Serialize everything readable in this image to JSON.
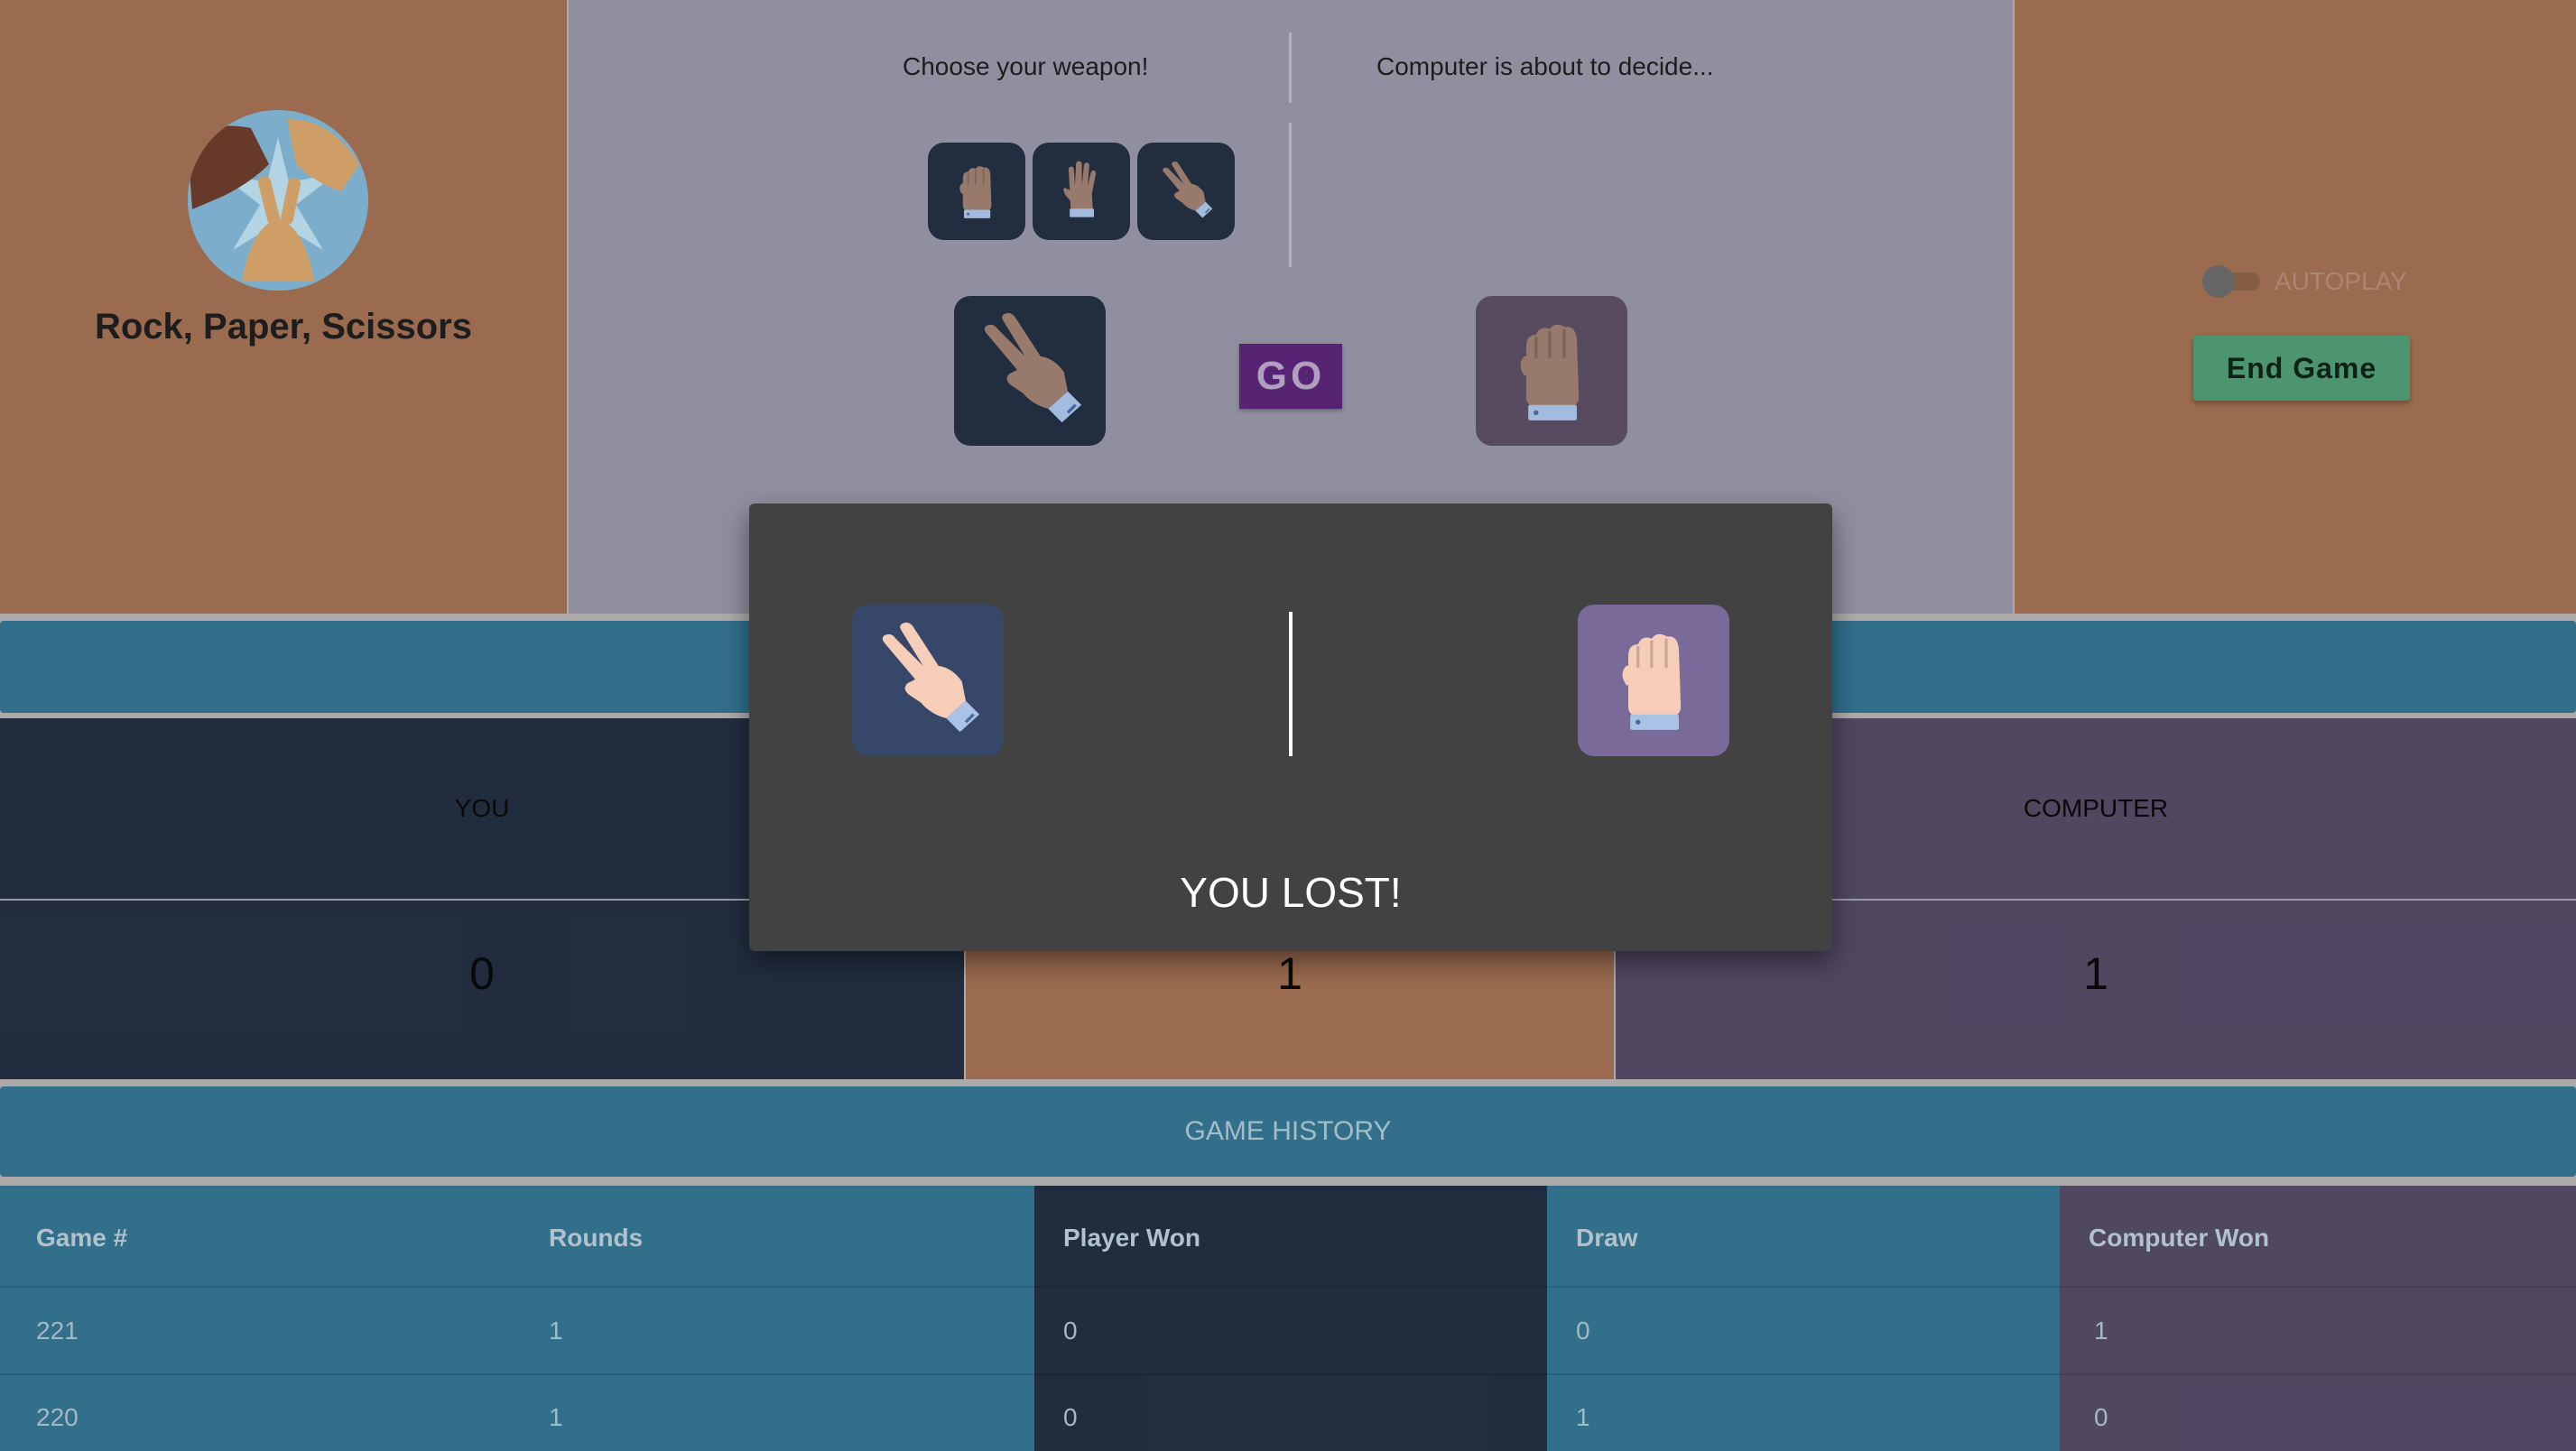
{
  "app": {
    "title": "Rock, Paper, Scissors",
    "logo_icon": "rock-paper-scissors-hands-logo"
  },
  "arena": {
    "player_prompt": "Choose your weapon!",
    "computer_prompt": "Computer is about to decide...",
    "weapons": [
      {
        "name": "rock",
        "icon": "fist-icon"
      },
      {
        "name": "paper",
        "icon": "open-hand-icon"
      },
      {
        "name": "scissors",
        "icon": "scissors-hand-icon"
      }
    ],
    "player_choice_icon": "scissors-hand-icon",
    "computer_choice_icon": "fist-icon",
    "go_label": "GO"
  },
  "controls": {
    "autoplay_label": "AUTOPLAY",
    "autoplay_on": false,
    "end_game_label": "End Game"
  },
  "scoreboard": {
    "you_label": "YOU",
    "you_score": "0",
    "draw_score": "1",
    "computer_label": "COMPUTER",
    "computer_score": "1"
  },
  "history": {
    "title": "GAME HISTORY",
    "columns": [
      "Game #",
      "Rounds",
      "Player Won",
      "Draw",
      "Computer Won"
    ],
    "rows": [
      [
        "221",
        "1",
        "0",
        "0",
        "1"
      ],
      [
        "220",
        "1",
        "0",
        "1",
        "0"
      ]
    ]
  },
  "result_modal": {
    "player_icon": "scissors-hand-icon",
    "computer_icon": "fist-icon",
    "message": "YOU LOST!"
  },
  "colors": {
    "side_panel": "#a06f52",
    "center_panel": "#9594a5",
    "player": "#232f42",
    "computer": "#534a65",
    "bar": "#337390",
    "go": "#5a2577",
    "end_game": "#4f9a72",
    "modal": "#424242"
  }
}
